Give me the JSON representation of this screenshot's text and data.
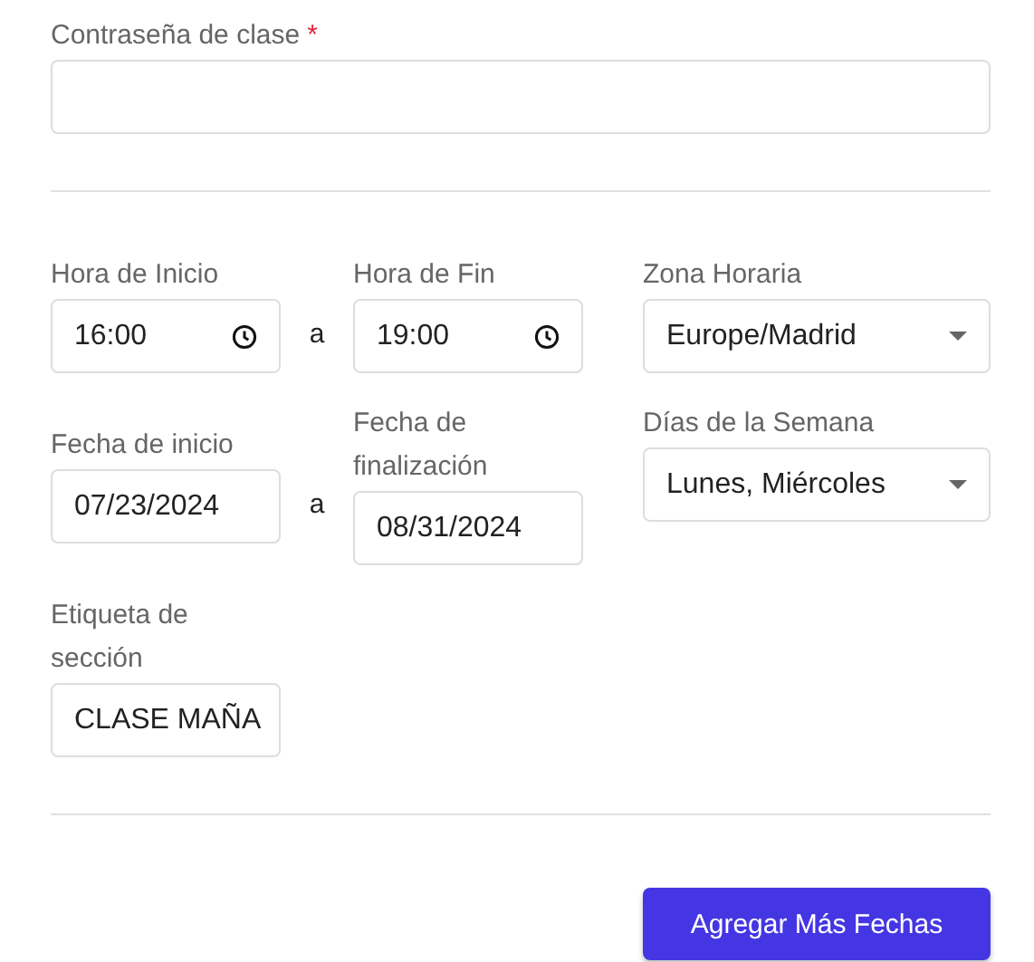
{
  "password": {
    "label": "Contraseña de clase",
    "required_mark": "*"
  },
  "schedule_rows": [
    {
      "start": {
        "label": "Hora de Inicio",
        "value": "16:00",
        "kind": "time"
      },
      "separator": "a",
      "end": {
        "label": "Hora de Fin",
        "value": "19:00",
        "kind": "time"
      },
      "side": {
        "label": "Zona Horaria",
        "value": "Europe/Madrid",
        "kind": "select"
      }
    },
    {
      "start": {
        "label": "Fecha de inicio",
        "value": "07/23/2024",
        "kind": "date"
      },
      "separator": "a",
      "end": {
        "label": "Fecha de finalización",
        "value": "08/31/2024",
        "kind": "date"
      },
      "side": {
        "label": "Días de la Semana",
        "value": "Lunes, Miércoles",
        "kind": "select"
      }
    }
  ],
  "section_label": {
    "label": "Etiqueta de sección",
    "value": "CLASE MAÑA"
  },
  "button": "Agregar Más Fechas"
}
